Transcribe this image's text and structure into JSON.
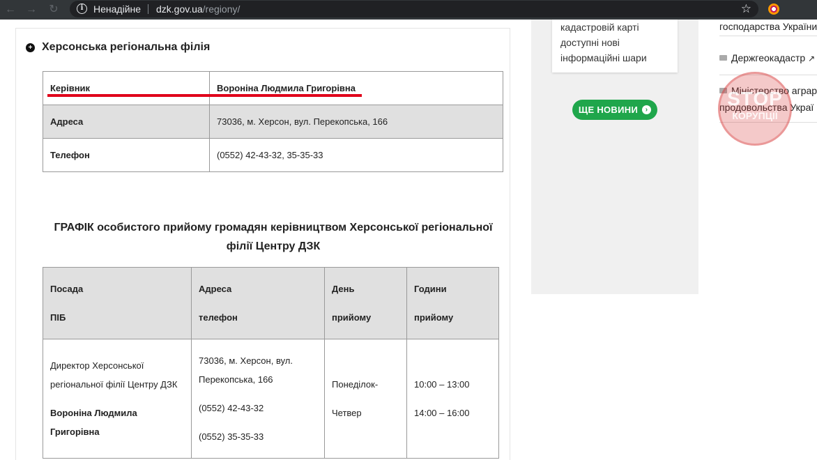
{
  "browser": {
    "security_label": "Ненадійне",
    "url_domain": "dzk.gov.ua",
    "url_path": "/regiony/"
  },
  "branch": {
    "title": "Херсонська регіональна філія",
    "rows": [
      {
        "key": "Керівник",
        "value": "Вороніна Людмила Григорівна"
      },
      {
        "key": "Адреса",
        "value": "73036, м. Херсон, вул. Перекопська, 166"
      },
      {
        "key": "Телефон",
        "value": "(0552) 42-43-32, 35-35-33"
      }
    ]
  },
  "schedule": {
    "title": "ГРАФІК особистого прийому громадян керівництвом Херсонської регіональної філії Центру ДЗК",
    "headers": [
      [
        "Посада",
        "ПІБ"
      ],
      [
        "Адреса",
        "телефон"
      ],
      [
        "День",
        "прийому"
      ],
      [
        "Години",
        "прийому"
      ]
    ],
    "row": {
      "position_line1": "Директор Херсонської",
      "position_line2": "регіональної філії Центру ДЗК",
      "name": "Вороніна Людмила Григорівна",
      "address_line1": "73036, м. Херсон, вул.",
      "address_line2": "Перекопська, 166",
      "phone1": "(0552) 42-43-32",
      "phone2": "(0552) 35-35-33",
      "day_line1": "Понеділок-",
      "day_line2": "Четвер",
      "hours1": "10:00 – 13:00",
      "hours2": "14:00 – 16:00"
    }
  },
  "news": {
    "card_lines": [
      "кадастровій карті",
      "доступні нові",
      "інформаційні шари"
    ],
    "more_button": "ЩЕ НОВИНИ"
  },
  "links": {
    "items": [
      "господарства України",
      "Держгеокадастр",
      "Міністерство аграрн",
      "продовольства Украї"
    ]
  },
  "stamp": {
    "line1": "STOP",
    "line2": "КОРУПЦІЇ"
  },
  "colors": {
    "accent_green": "#1fa64b",
    "highlight_red": "#e0001a"
  }
}
